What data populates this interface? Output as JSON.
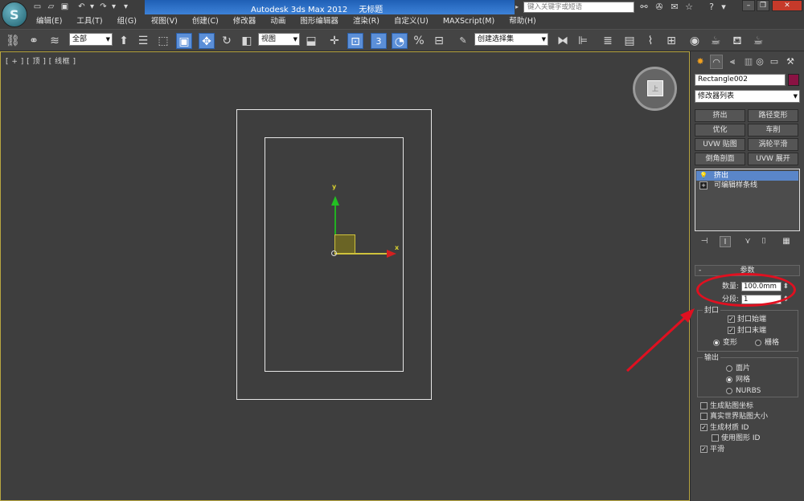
{
  "title": {
    "app": "Autodesk 3ds Max  2012",
    "file": "无标题"
  },
  "search": {
    "placeholder": "键入关键字或短语"
  },
  "menu": [
    "编辑(E)",
    "工具(T)",
    "组(G)",
    "视图(V)",
    "创建(C)",
    "修改器",
    "动画",
    "图形编辑器",
    "渲染(R)",
    "自定义(U)",
    "MAXScript(M)",
    "帮助(H)"
  ],
  "toolbar": {
    "selection_filter": "全部",
    "reference_coord": "视图",
    "named_selection": "创建选择集"
  },
  "viewport": {
    "label": "[ + ] [ 顶 ] [ 线框 ]",
    "viewcube_face": "上",
    "axis_x": "x",
    "axis_y": "y"
  },
  "panel": {
    "object_name": "Rectangle002",
    "object_color": "#8a1243",
    "modifier_list": "修改器列表",
    "modifier_buttons": [
      "挤出",
      "路径变形",
      "优化",
      "车削",
      "UVW 贴图",
      "涡轮平滑",
      "倒角剖面",
      "UVW 展开"
    ],
    "stack": [
      "挤出",
      "可编辑样条线"
    ],
    "params_title": "参数",
    "amount_label": "数量:",
    "amount_value": "100.0mm",
    "segments_label": "分段:",
    "segments_value": "1",
    "capping_group": "封口",
    "cap_start": "封口始端",
    "cap_end": "封口末端",
    "morph": "变形",
    "grid": "栅格",
    "output_group": "输出",
    "out_patch": "面片",
    "out_mesh": "网格",
    "out_nurbs": "NURBS",
    "gen_map_coords": "生成贴图坐标",
    "real_world_map": "真实世界贴图大小",
    "gen_mat_ids": "生成材质 ID",
    "use_shape_ids": "使用图形 ID",
    "smooth": "平滑"
  },
  "annotation": {
    "color": "#e01020"
  }
}
